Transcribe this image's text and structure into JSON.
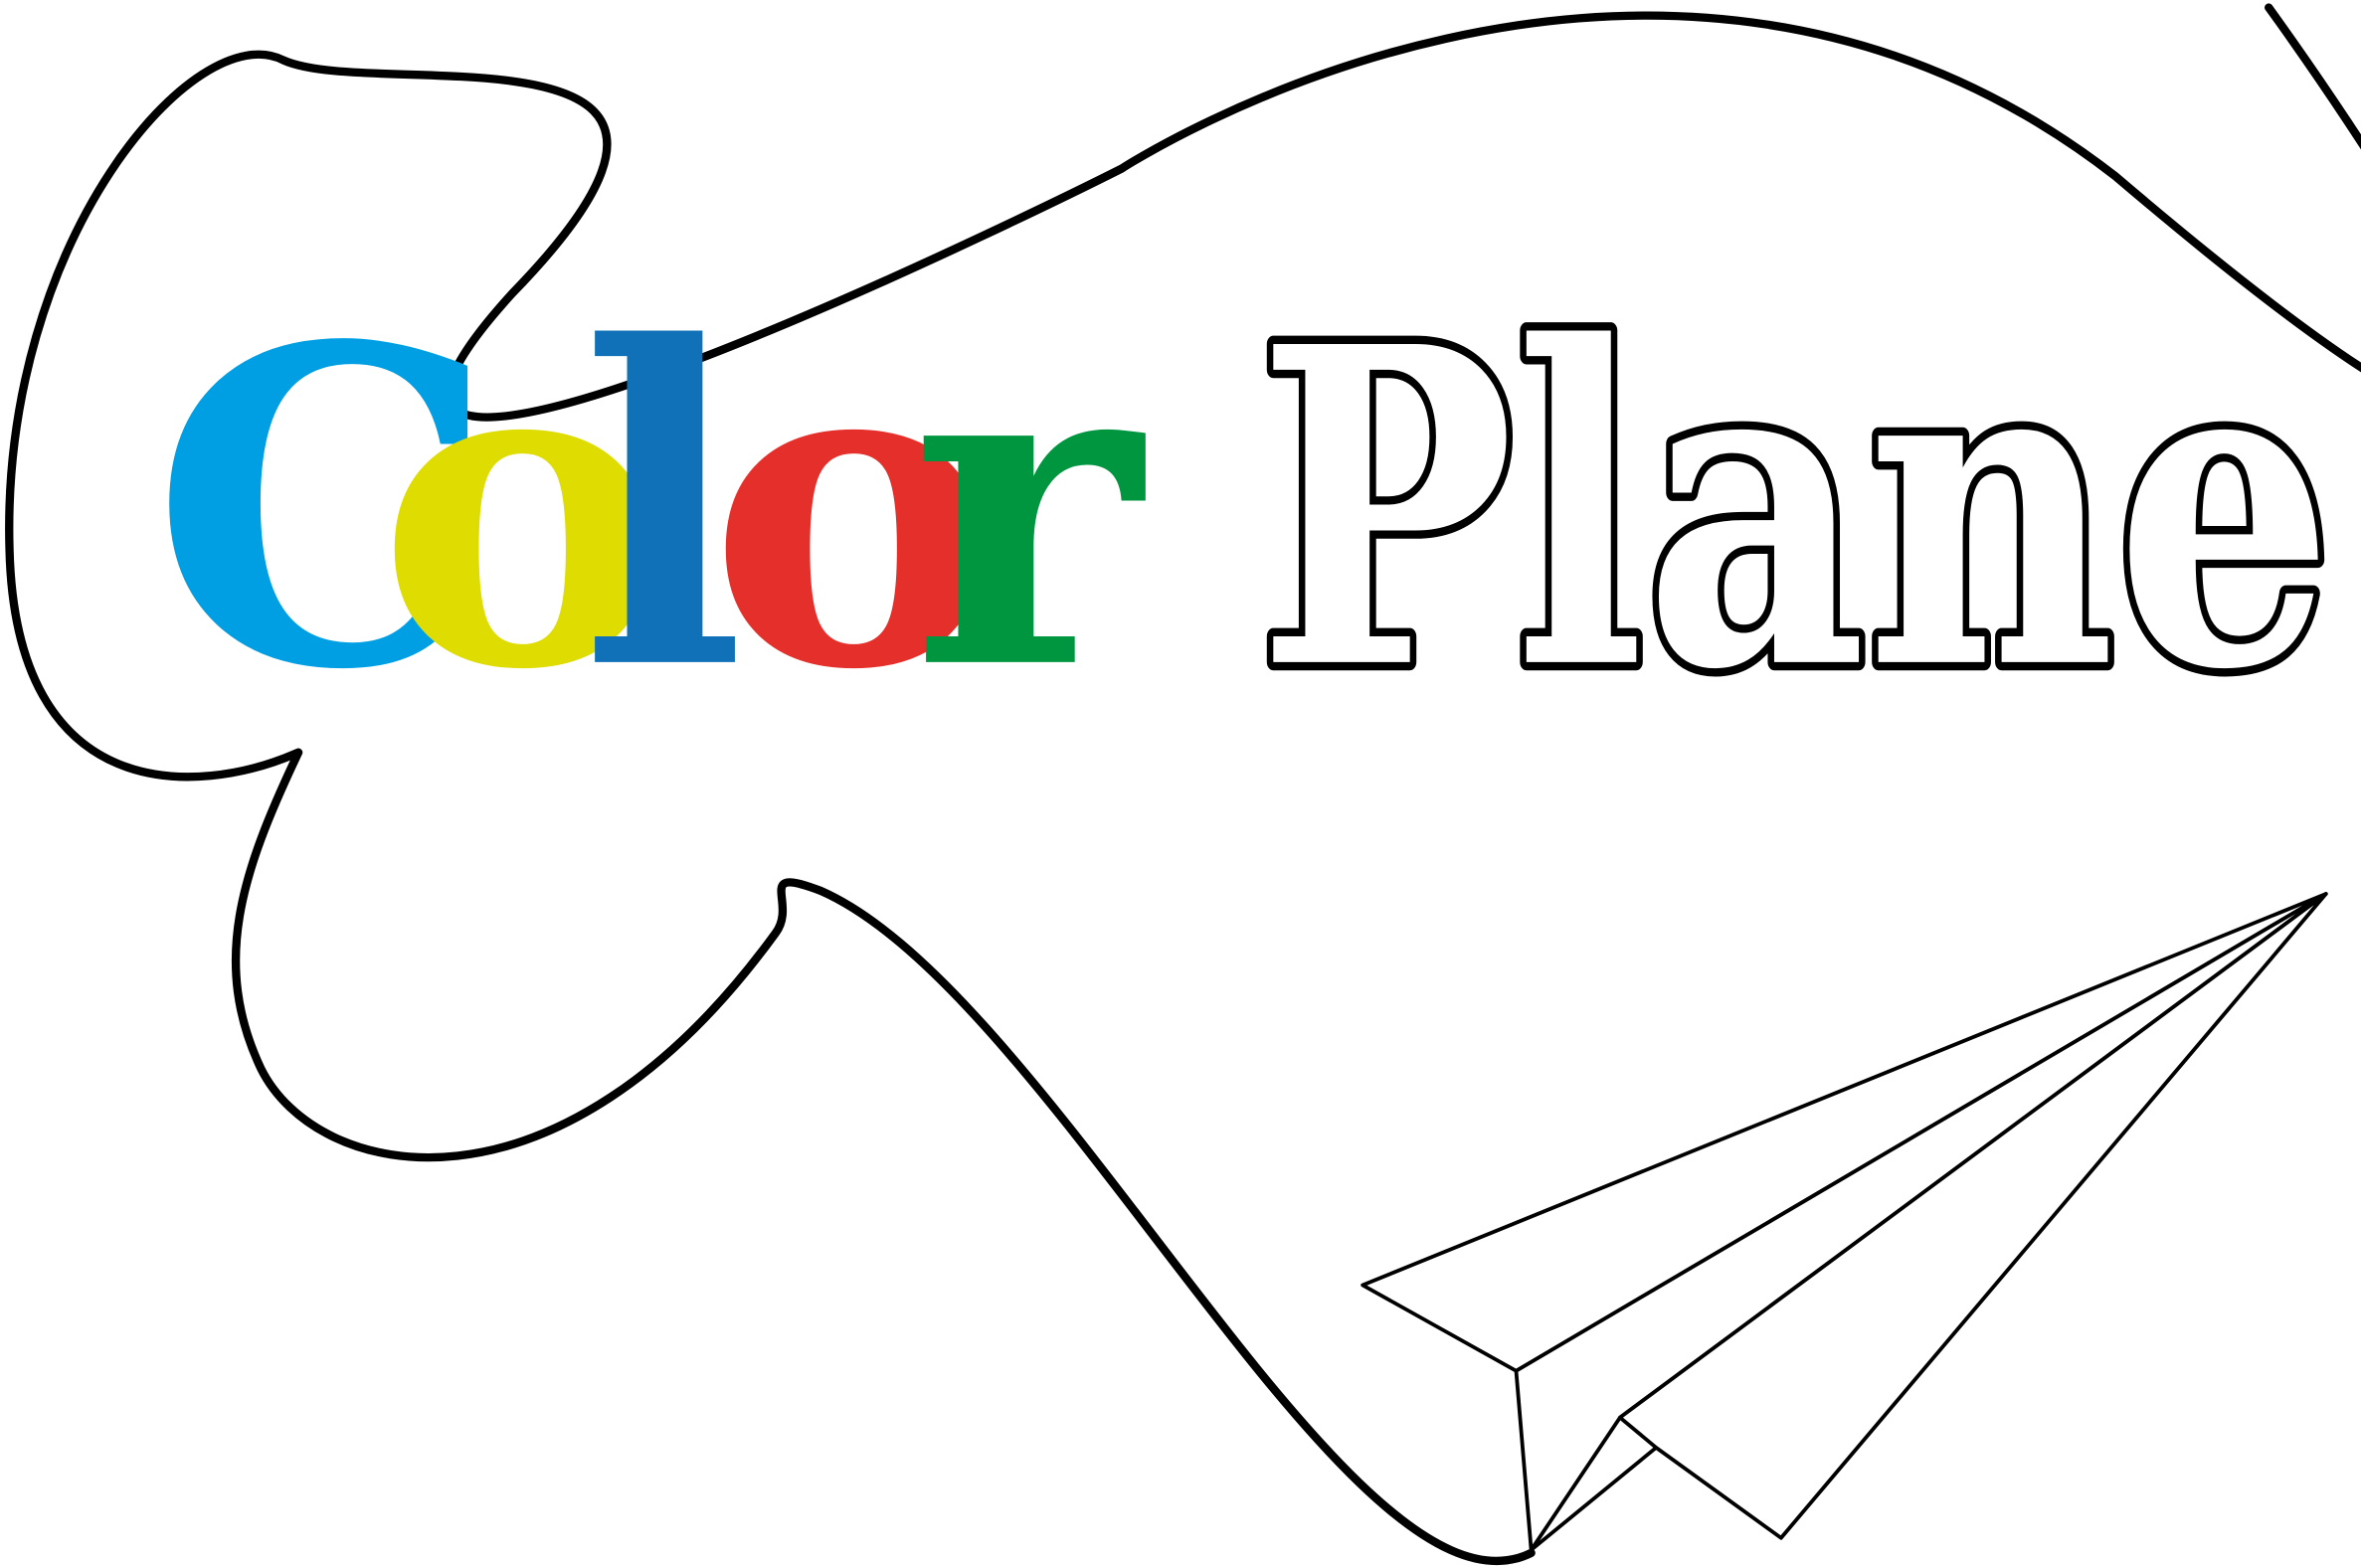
{
  "logo": {
    "word_color": "Color",
    "word_plane": "Plane",
    "letter_colors": [
      "#009fe3",
      "#dedc00",
      "#1071b8",
      "#e52f2b",
      "#009640"
    ],
    "outline_color": "#000000",
    "background": "#ffffff"
  },
  "graphics": {
    "flight_path": "looping-trail-line",
    "plane": "paper-plane-icon"
  }
}
